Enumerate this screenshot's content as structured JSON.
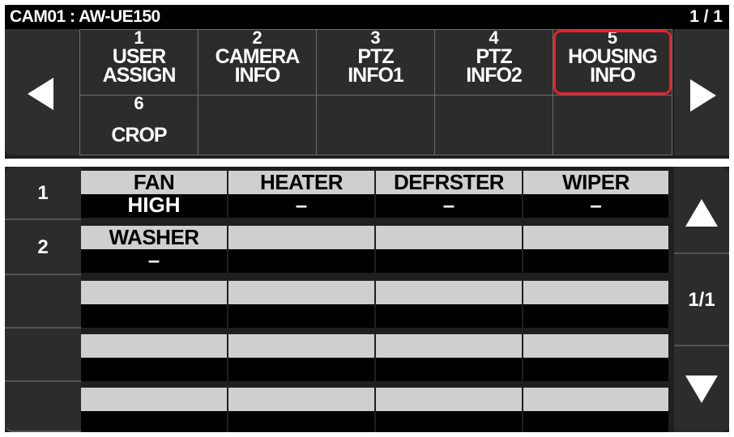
{
  "title_bar": {
    "camera": "CAM01 : AW-UE150",
    "page": "1 / 1"
  },
  "menu": {
    "items": [
      {
        "num": "1",
        "line1": "USER",
        "line2": "ASSIGN"
      },
      {
        "num": "2",
        "line1": "CAMERA",
        "line2": "INFO"
      },
      {
        "num": "3",
        "line1": "PTZ",
        "line2": "INFO1"
      },
      {
        "num": "4",
        "line1": "PTZ",
        "line2": "INFO2"
      },
      {
        "num": "5",
        "line1": "HOUSING",
        "line2": "INFO"
      },
      {
        "num": "6",
        "line1": "",
        "line2": "CROP"
      }
    ],
    "selected": "5",
    "prev_icon": "left-triangle",
    "next_icon": "right-triangle"
  },
  "rows": {
    "row_labels": [
      "1",
      "2"
    ],
    "items": [
      {
        "name": "FAN",
        "value": "HIGH"
      },
      {
        "name": "HEATER",
        "value": "–"
      },
      {
        "name": "DEFRSTER",
        "value": "–"
      },
      {
        "name": "WIPER",
        "value": "–"
      },
      {
        "name": "WASHER",
        "value": "–"
      }
    ]
  },
  "scroll": {
    "page": "1/1",
    "up_icon": "up-triangle",
    "down_icon": "down-triangle"
  },
  "colors": {
    "selection": "#e4222a",
    "header_bg": "#cfcfcf",
    "panel_bg": "#1f1f1f"
  }
}
